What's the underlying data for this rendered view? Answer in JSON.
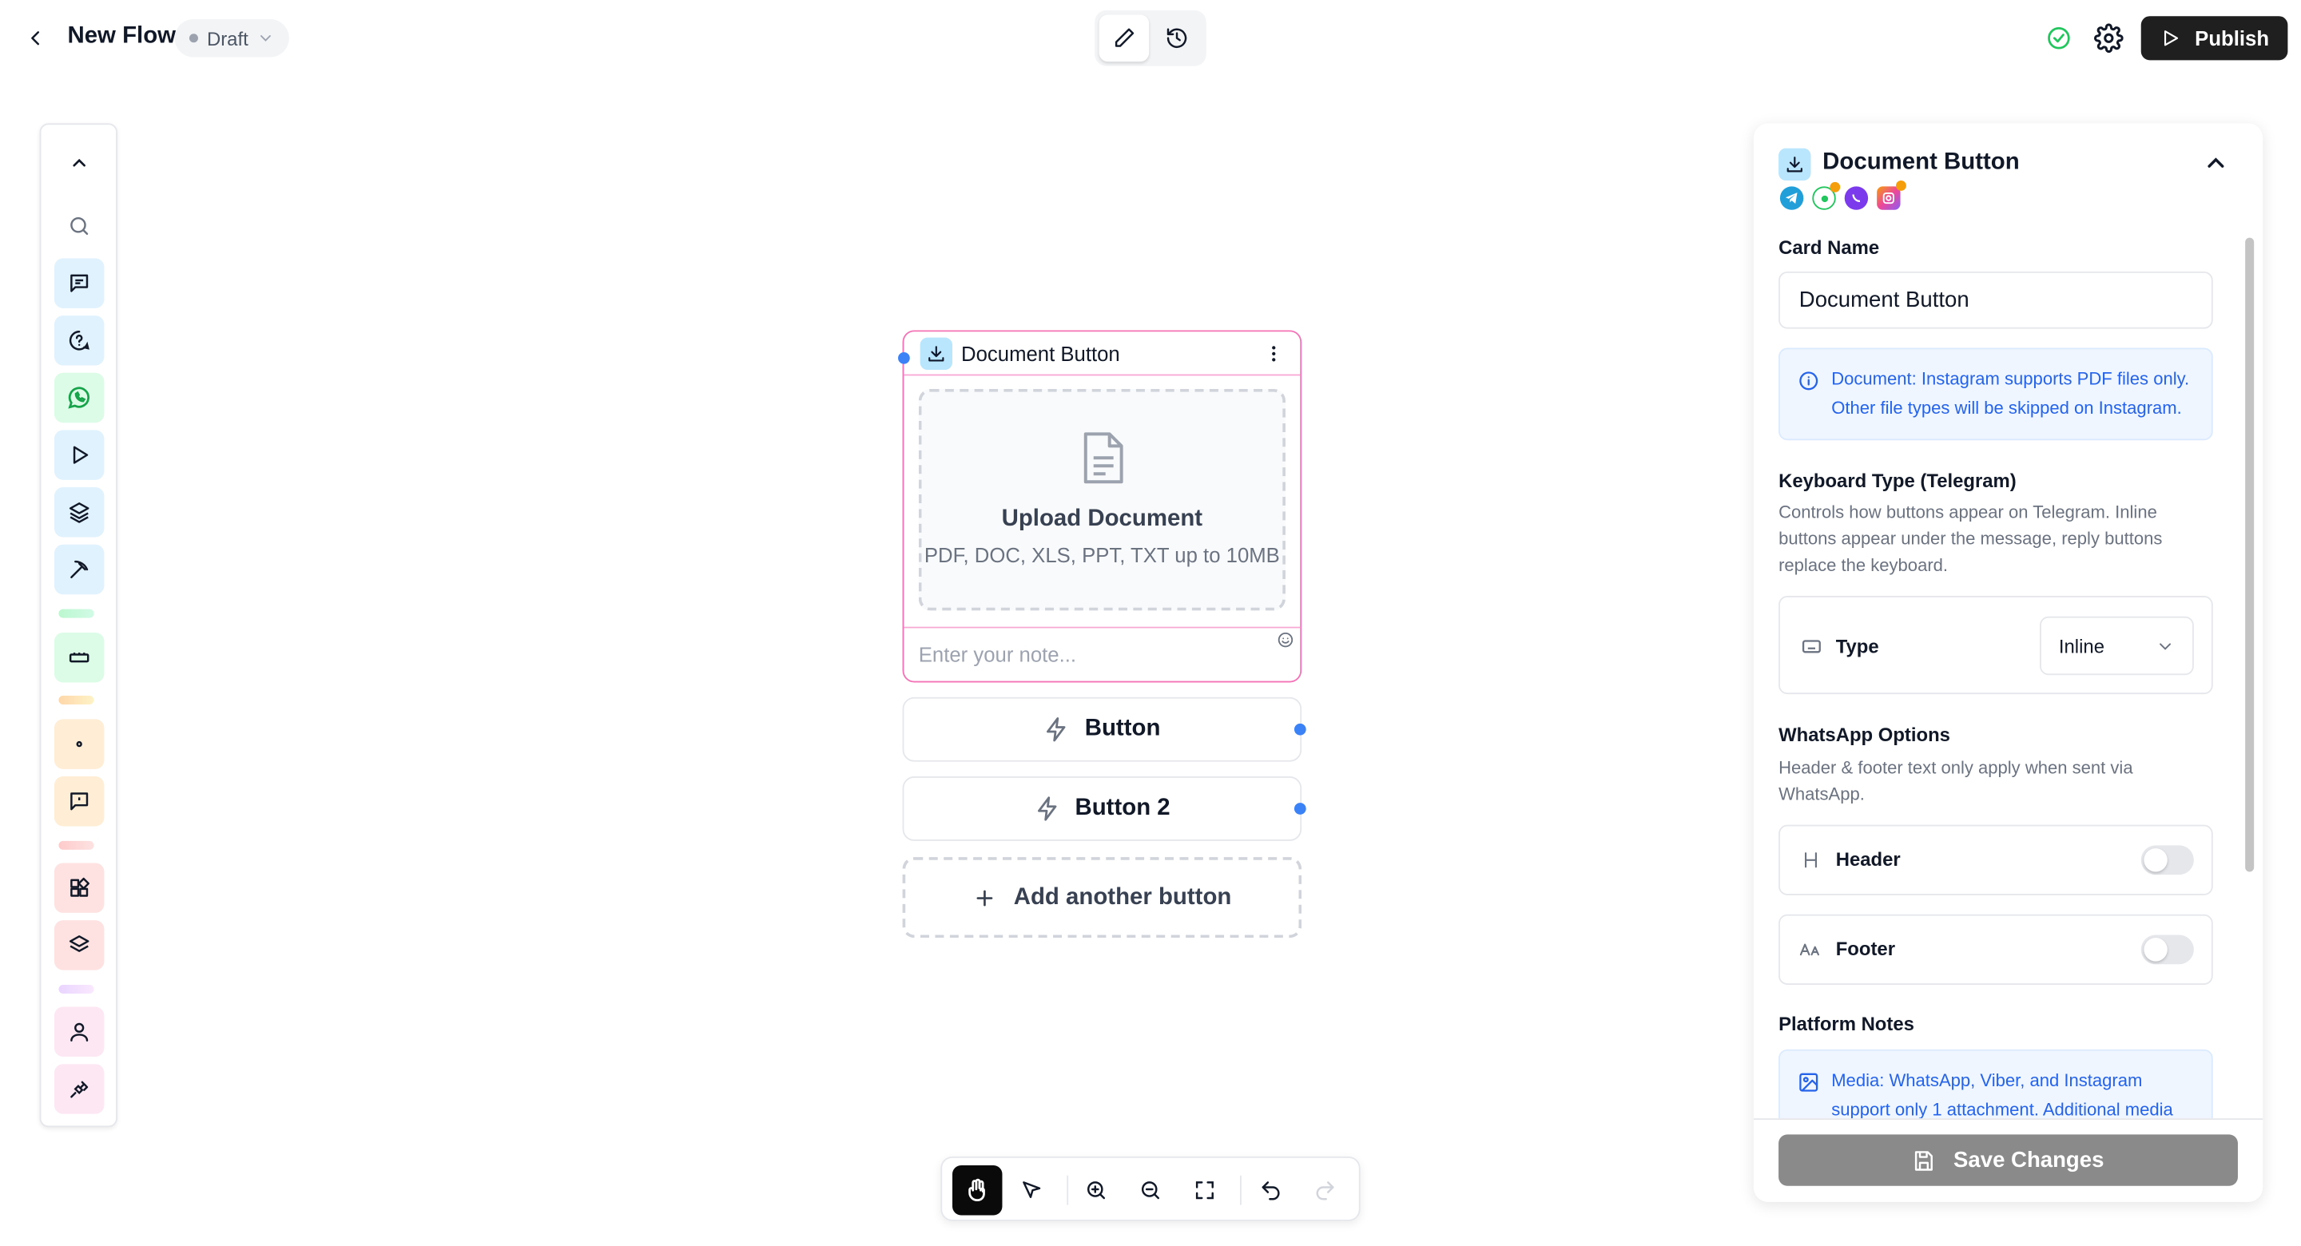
{
  "header": {
    "flow_name": "New Flow",
    "status_label": "Draft",
    "publish_label": "Publish"
  },
  "node": {
    "title": "Document Button",
    "upload_title": "Upload Document",
    "upload_subtitle": "PDF, DOC, XLS, PPT, TXT up to 10MB",
    "note_placeholder": "Enter your note...",
    "buttons": [
      {
        "label": "Button"
      },
      {
        "label": "Button 2"
      }
    ],
    "add_button_label": "Add another button"
  },
  "panel": {
    "title": "Document Button",
    "platforms": [
      "telegram-icon",
      "whatsapp-icon",
      "viber-icon",
      "instagram-icon"
    ],
    "card_name_label": "Card Name",
    "card_name_value": "Document Button",
    "document_info": "Document: Instagram supports PDF files only. Other file types will be skipped on Instagram.",
    "keyboard_label": "Keyboard Type (Telegram)",
    "keyboard_desc": "Controls how buttons appear on Telegram. Inline buttons appear under the message, reply buttons replace the keyboard.",
    "type_label": "Type",
    "type_value": "Inline",
    "whatsapp_label": "WhatsApp Options",
    "whatsapp_desc": "Header & footer text only apply when sent via WhatsApp.",
    "header_label": "Header",
    "header_enabled": false,
    "footer_label": "Footer",
    "footer_enabled": false,
    "platform_notes_label": "Platform Notes",
    "media_note": "Media: WhatsApp, Viber, and Instagram support only 1 attachment. Additional media",
    "save_label": "Save Changes"
  },
  "colors": {
    "accent_blue": "#3b82f6",
    "node_border": "#f472b6",
    "publish_bg": "#1f1f1f",
    "save_bg": "#8a8a8a",
    "info_text": "#2563eb",
    "status_ok": "#22c55e"
  }
}
